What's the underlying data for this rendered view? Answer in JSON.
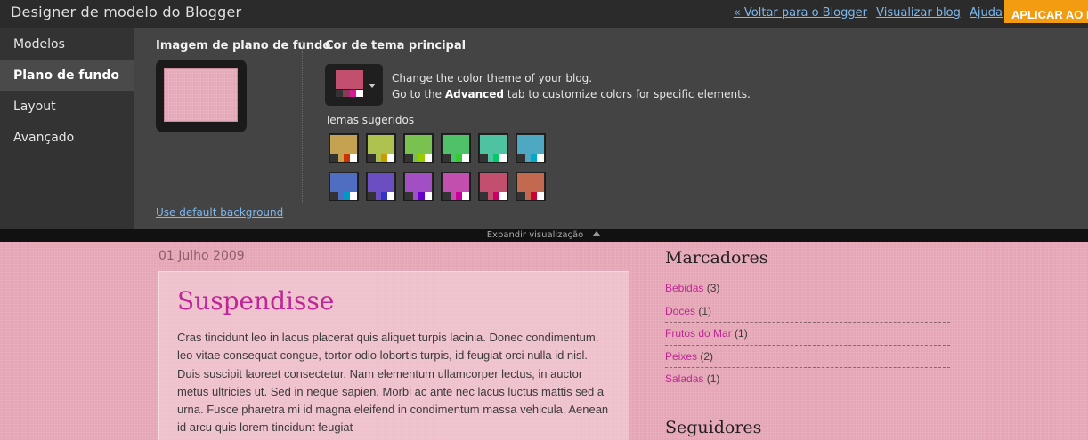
{
  "header": {
    "title": "Designer de modelo do Blogger",
    "links": [
      "« Voltar para o Blogger",
      "Visualizar blog",
      "Ajuda"
    ],
    "apply_label": "APLICAR AO BLOG"
  },
  "sidebar": {
    "items": [
      {
        "label": "Modelos",
        "active": false
      },
      {
        "label": "Plano de fundo",
        "active": true
      },
      {
        "label": "Layout",
        "active": false
      },
      {
        "label": "Avançado",
        "active": false
      }
    ]
  },
  "panel": {
    "bg_title": "Imagem de plano de fundo",
    "default_link": "Use default background",
    "theme_title": "Cor de tema principal",
    "theme_desc_1": "Change the color theme of your blog.",
    "theme_desc_2_pre": "Go to the ",
    "theme_desc_2_bold": "Advanced",
    "theme_desc_2_post": " tab to customize colors for specific elements.",
    "suggested_title": "Temas sugeridos",
    "current_theme": {
      "main": "#c24f6e",
      "strip": [
        "#333333",
        "#8a3a55",
        "#d51d9a",
        "#ffffff"
      ]
    },
    "swatches": [
      {
        "main": "#c4a251",
        "accent": "#cc3300"
      },
      {
        "main": "#aec24f",
        "accent": "#cc9900"
      },
      {
        "main": "#7ac24f",
        "accent": "#99cc00"
      },
      {
        "main": "#4fc269",
        "accent": "#33cc33"
      },
      {
        "main": "#4fc2a1",
        "accent": "#00cc66"
      },
      {
        "main": "#4fa8c2",
        "accent": "#00aacc"
      },
      {
        "main": "#4f6ec2",
        "accent": "#0099cc"
      },
      {
        "main": "#6b4fc2",
        "accent": "#3333cc"
      },
      {
        "main": "#a14fc2",
        "accent": "#6600cc"
      },
      {
        "main": "#c24fae",
        "accent": "#cc0099"
      },
      {
        "main": "#c24f6e",
        "accent": "#cc0066"
      },
      {
        "main": "#c2694f",
        "accent": "#cc0033"
      }
    ]
  },
  "expand": {
    "label": "Expandir visualização"
  },
  "preview": {
    "date": "01 Julho 2009",
    "post_title": "Suspendisse",
    "post_body": "Cras tincidunt leo in lacus placerat quis aliquet turpis lacinia. Donec condimentum, leo vitae consequat congue, tortor odio lobortis turpis, id feugiat orci nulla id nisl. Duis suscipit laoreet consectetur. Nam elementum ullamcorper lectus, in auctor metus ultricies ut. Sed in neque sapien. Morbi ac ante nec lacus luctus mattis sed a urna. Fusce pharetra mi id magna eleifend in condimentum massa vehicula. Aenean id arcu quis lorem tincidunt feugiat",
    "labels_title": "Marcadores",
    "labels": [
      {
        "name": "Bebidas",
        "count": "(3)"
      },
      {
        "name": "Doces",
        "count": "(1)"
      },
      {
        "name": "Frutos do Mar",
        "count": "(1)"
      },
      {
        "name": "Peixes",
        "count": "(2)"
      },
      {
        "name": "Saladas",
        "count": "(1)"
      }
    ],
    "followers_title": "Seguidores"
  }
}
